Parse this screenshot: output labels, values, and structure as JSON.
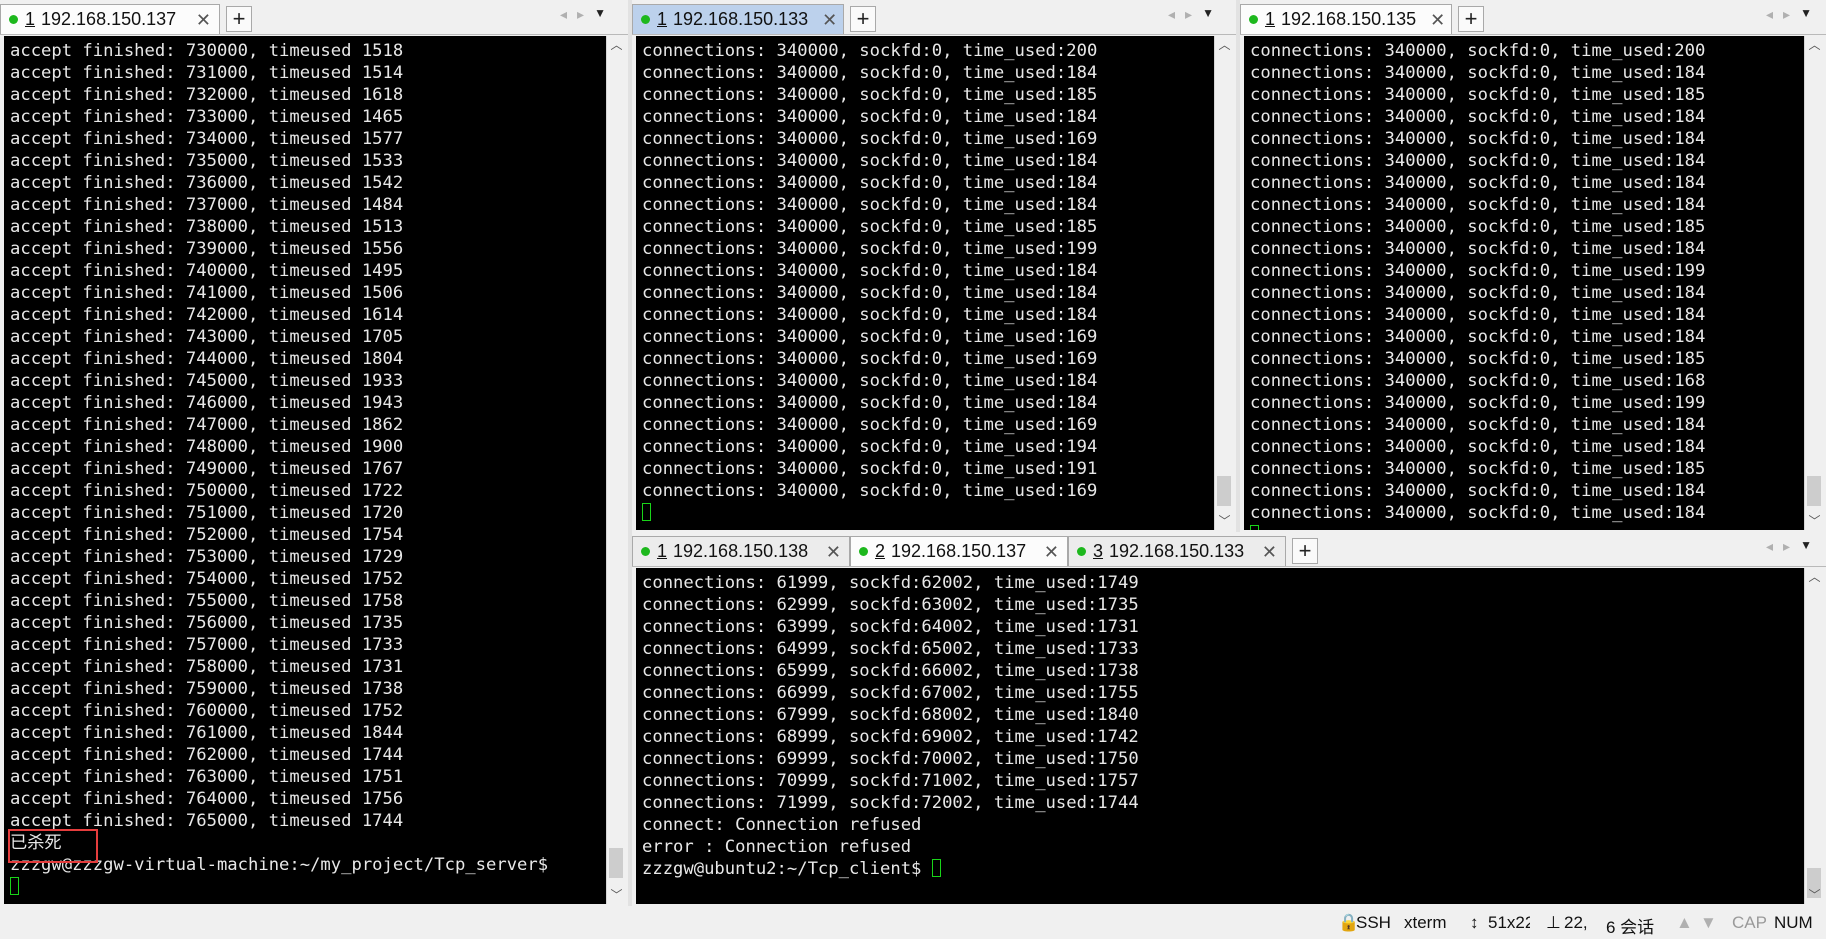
{
  "panes": {
    "left": {
      "tabs": [
        {
          "num": "1",
          "addr": "192.168.150.137"
        }
      ],
      "lines": [
        "accept finished: 730000, timeused 1518",
        "accept finished: 731000, timeused 1514",
        "accept finished: 732000, timeused 1618",
        "accept finished: 733000, timeused 1465",
        "accept finished: 734000, timeused 1577",
        "accept finished: 735000, timeused 1533",
        "accept finished: 736000, timeused 1542",
        "accept finished: 737000, timeused 1484",
        "accept finished: 738000, timeused 1513",
        "accept finished: 739000, timeused 1556",
        "accept finished: 740000, timeused 1495",
        "accept finished: 741000, timeused 1506",
        "accept finished: 742000, timeused 1614",
        "accept finished: 743000, timeused 1705",
        "accept finished: 744000, timeused 1804",
        "accept finished: 745000, timeused 1933",
        "accept finished: 746000, timeused 1943",
        "accept finished: 747000, timeused 1862",
        "accept finished: 748000, timeused 1900",
        "accept finished: 749000, timeused 1767",
        "accept finished: 750000, timeused 1722",
        "accept finished: 751000, timeused 1720",
        "accept finished: 752000, timeused 1754",
        "accept finished: 753000, timeused 1729",
        "accept finished: 754000, timeused 1752",
        "accept finished: 755000, timeused 1758",
        "accept finished: 756000, timeused 1735",
        "accept finished: 757000, timeused 1733",
        "accept finished: 758000, timeused 1731",
        "accept finished: 759000, timeused 1738",
        "accept finished: 760000, timeused 1752",
        "accept finished: 761000, timeused 1844",
        "accept finished: 762000, timeused 1744",
        "accept finished: 763000, timeused 1751",
        "accept finished: 764000, timeused 1756",
        "accept finished: 765000, timeused 1744",
        "已杀死",
        "zzzgw@zzzgw-virtual-machine:~/my_project/Tcp_server$ "
      ]
    },
    "top_middle": {
      "tabs": [
        {
          "num": "1",
          "addr": "192.168.150.133"
        }
      ],
      "lines": [
        "connections: 340000, sockfd:0, time_used:200",
        "connections: 340000, sockfd:0, time_used:184",
        "connections: 340000, sockfd:0, time_used:185",
        "connections: 340000, sockfd:0, time_used:184",
        "connections: 340000, sockfd:0, time_used:169",
        "connections: 340000, sockfd:0, time_used:184",
        "connections: 340000, sockfd:0, time_used:184",
        "connections: 340000, sockfd:0, time_used:184",
        "connections: 340000, sockfd:0, time_used:185",
        "connections: 340000, sockfd:0, time_used:199",
        "connections: 340000, sockfd:0, time_used:184",
        "connections: 340000, sockfd:0, time_used:184",
        "connections: 340000, sockfd:0, time_used:184",
        "connections: 340000, sockfd:0, time_used:169",
        "connections: 340000, sockfd:0, time_used:169",
        "connections: 340000, sockfd:0, time_used:184",
        "connections: 340000, sockfd:0, time_used:184",
        "connections: 340000, sockfd:0, time_used:169",
        "connections: 340000, sockfd:0, time_used:194",
        "connections: 340000, sockfd:0, time_used:191",
        "connections: 340000, sockfd:0, time_used:169"
      ]
    },
    "top_right": {
      "tabs": [
        {
          "num": "1",
          "addr": "192.168.150.135"
        }
      ],
      "lines": [
        "connections: 340000, sockfd:0, time_used:200",
        "connections: 340000, sockfd:0, time_used:184",
        "connections: 340000, sockfd:0, time_used:185",
        "connections: 340000, sockfd:0, time_used:184",
        "connections: 340000, sockfd:0, time_used:184",
        "connections: 340000, sockfd:0, time_used:184",
        "connections: 340000, sockfd:0, time_used:184",
        "connections: 340000, sockfd:0, time_used:184",
        "connections: 340000, sockfd:0, time_used:185",
        "connections: 340000, sockfd:0, time_used:184",
        "connections: 340000, sockfd:0, time_used:199",
        "connections: 340000, sockfd:0, time_used:184",
        "connections: 340000, sockfd:0, time_used:184",
        "connections: 340000, sockfd:0, time_used:184",
        "connections: 340000, sockfd:0, time_used:185",
        "connections: 340000, sockfd:0, time_used:168",
        "connections: 340000, sockfd:0, time_used:199",
        "connections: 340000, sockfd:0, time_used:184",
        "connections: 340000, sockfd:0, time_used:184",
        "connections: 340000, sockfd:0, time_used:185",
        "connections: 340000, sockfd:0, time_used:184",
        "connections: 340000, sockfd:0, time_used:184"
      ]
    },
    "bottom": {
      "tabs": [
        {
          "num": "1",
          "addr": "192.168.150.138"
        },
        {
          "num": "2",
          "addr": "192.168.150.137"
        },
        {
          "num": "3",
          "addr": "192.168.150.133"
        }
      ],
      "lines": [
        "connections: 61999, sockfd:62002, time_used:1749",
        "connections: 62999, sockfd:63002, time_used:1735",
        "connections: 63999, sockfd:64002, time_used:1731",
        "connections: 64999, sockfd:65002, time_used:1733",
        "connections: 65999, sockfd:66002, time_used:1738",
        "connections: 66999, sockfd:67002, time_used:1755",
        "connections: 67999, sockfd:68002, time_used:1840",
        "connections: 68999, sockfd:69002, time_used:1742",
        "connections: 69999, sockfd:70002, time_used:1750",
        "connections: 70999, sockfd:71002, time_used:1757",
        "connections: 71999, sockfd:72002, time_used:1744",
        "connect: Connection refused",
        "error : Connection refused",
        "zzzgw@ubuntu2:~/Tcp_client$ "
      ]
    }
  },
  "statusbar": {
    "protocol": "SSH",
    "terminal": "xterm",
    "size": "51x22",
    "cursor_pos": "22,",
    "sessions": "6 会话",
    "cap": "CAP",
    "num": "NUM"
  },
  "colors": {
    "terminal_bg": "#000000",
    "terminal_fg": "#e8e8e8",
    "cursor": "#19d419",
    "active_tab": "#bcd1ec",
    "highlight_box": "#e53d3d",
    "status_dot": "#1db81d"
  },
  "icons": {
    "tab_close": "close-icon",
    "tab_add": "plus-icon",
    "scroll_up": "chevron-up-icon",
    "scroll_down": "chevron-down-icon",
    "tab_nav": "chevron-left-right-icon",
    "tab_menu": "caret-down-icon",
    "connected": "green-dot-icon"
  }
}
